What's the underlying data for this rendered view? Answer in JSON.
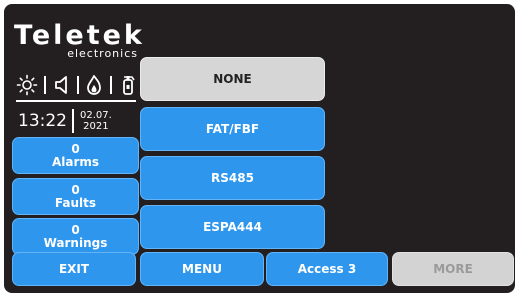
{
  "brand": {
    "name": "Teletek",
    "sub": "electronics"
  },
  "status_icons": [
    "sun-icon",
    "speaker-icon",
    "fire-icon",
    "extinguisher-icon"
  ],
  "clock": {
    "time": "13:22",
    "date_line1": "02.07.",
    "date_line2": "2021"
  },
  "counters": [
    {
      "value": "0",
      "label": "Alarms"
    },
    {
      "value": "0",
      "label": "Faults"
    },
    {
      "value": "0",
      "label": "Warnings"
    }
  ],
  "options": [
    {
      "label": "NONE",
      "selected": true
    },
    {
      "label": "FAT/FBF",
      "selected": false
    },
    {
      "label": "RS485",
      "selected": false
    },
    {
      "label": "ESPA444",
      "selected": false
    }
  ],
  "bottom": {
    "exit": "EXIT",
    "menu": "MENU",
    "access": "Access 3",
    "more": "MORE"
  },
  "colors": {
    "button": "#2f96ee",
    "background": "#231f20",
    "selected": "#d6d6d6",
    "disabled": "#d4d3d3"
  }
}
